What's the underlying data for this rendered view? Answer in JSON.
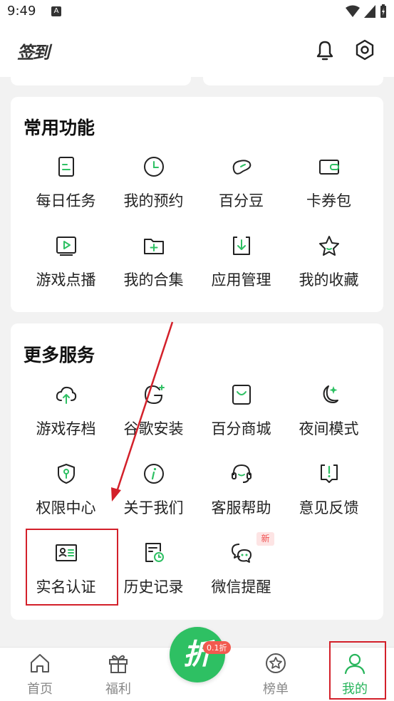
{
  "status_bar": {
    "time": "9:49",
    "notif_letter": "A"
  },
  "header": {
    "title": "签到",
    "icons": [
      "bell-icon",
      "gear-icon"
    ]
  },
  "common": {
    "title": "常用功能",
    "items": [
      {
        "label": "每日任务",
        "icon": "task-icon"
      },
      {
        "label": "我的预约",
        "icon": "clock-icon"
      },
      {
        "label": "百分豆",
        "icon": "bean-icon"
      },
      {
        "label": "卡券包",
        "icon": "wallet-icon"
      },
      {
        "label": "游戏点播",
        "icon": "play-icon"
      },
      {
        "label": "我的合集",
        "icon": "folder-plus-icon"
      },
      {
        "label": "应用管理",
        "icon": "download-box-icon"
      },
      {
        "label": "我的收藏",
        "icon": "star-icon"
      }
    ]
  },
  "more": {
    "title": "更多服务",
    "items": [
      {
        "label": "游戏存档",
        "icon": "cloud-upload-icon"
      },
      {
        "label": "谷歌安装",
        "icon": "google-icon"
      },
      {
        "label": "百分商城",
        "icon": "shop-bag-icon"
      },
      {
        "label": "夜间模式",
        "icon": "moon-icon"
      },
      {
        "label": "权限中心",
        "icon": "shield-key-icon"
      },
      {
        "label": "关于我们",
        "icon": "info-icon"
      },
      {
        "label": "客服帮助",
        "icon": "headset-icon"
      },
      {
        "label": "意见反馈",
        "icon": "feedback-icon"
      },
      {
        "label": "实名认证",
        "icon": "id-card-icon"
      },
      {
        "label": "历史记录",
        "icon": "history-icon"
      },
      {
        "label": "微信提醒",
        "icon": "wechat-icon"
      }
    ],
    "new_badge": "新"
  },
  "tabbar": {
    "tabs": [
      {
        "label": "首页",
        "icon": "home-icon"
      },
      {
        "label": "福利",
        "icon": "gift-icon"
      },
      {
        "label": "榜单",
        "icon": "ranking-icon"
      },
      {
        "label": "我的",
        "icon": "profile-icon"
      }
    ],
    "center": {
      "char": "折",
      "badge": "0.1折"
    },
    "active_color": "#27b55b"
  },
  "colors": {
    "accent": "#27b55b",
    "annotation": "#d3202a"
  }
}
